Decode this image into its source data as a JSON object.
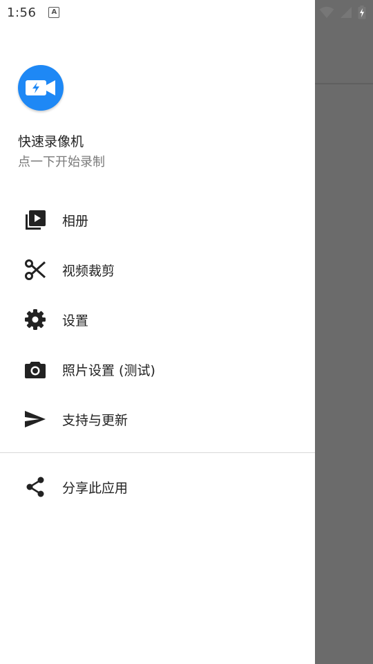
{
  "status_bar": {
    "time": "1:56",
    "notification_icon": "a-icon",
    "status_icons": [
      "wifi-icon",
      "signal-icon",
      "battery-charging-icon"
    ]
  },
  "drawer": {
    "app_name": "快速录像机",
    "app_subtitle": "点一下开始录制",
    "logo_icon": "video-camera-flash-icon",
    "accent_color": "#1e88f5",
    "menu_items": [
      {
        "icon": "video-library-icon",
        "label": "相册"
      },
      {
        "icon": "scissors-icon",
        "label": "视频裁剪"
      },
      {
        "icon": "gear-icon",
        "label": "设置"
      },
      {
        "icon": "camera-icon",
        "label": "照片设置 (测试)"
      },
      {
        "icon": "send-icon",
        "label": "支持与更新"
      }
    ],
    "secondary_items": [
      {
        "icon": "share-icon",
        "label": "分享此应用"
      }
    ]
  }
}
